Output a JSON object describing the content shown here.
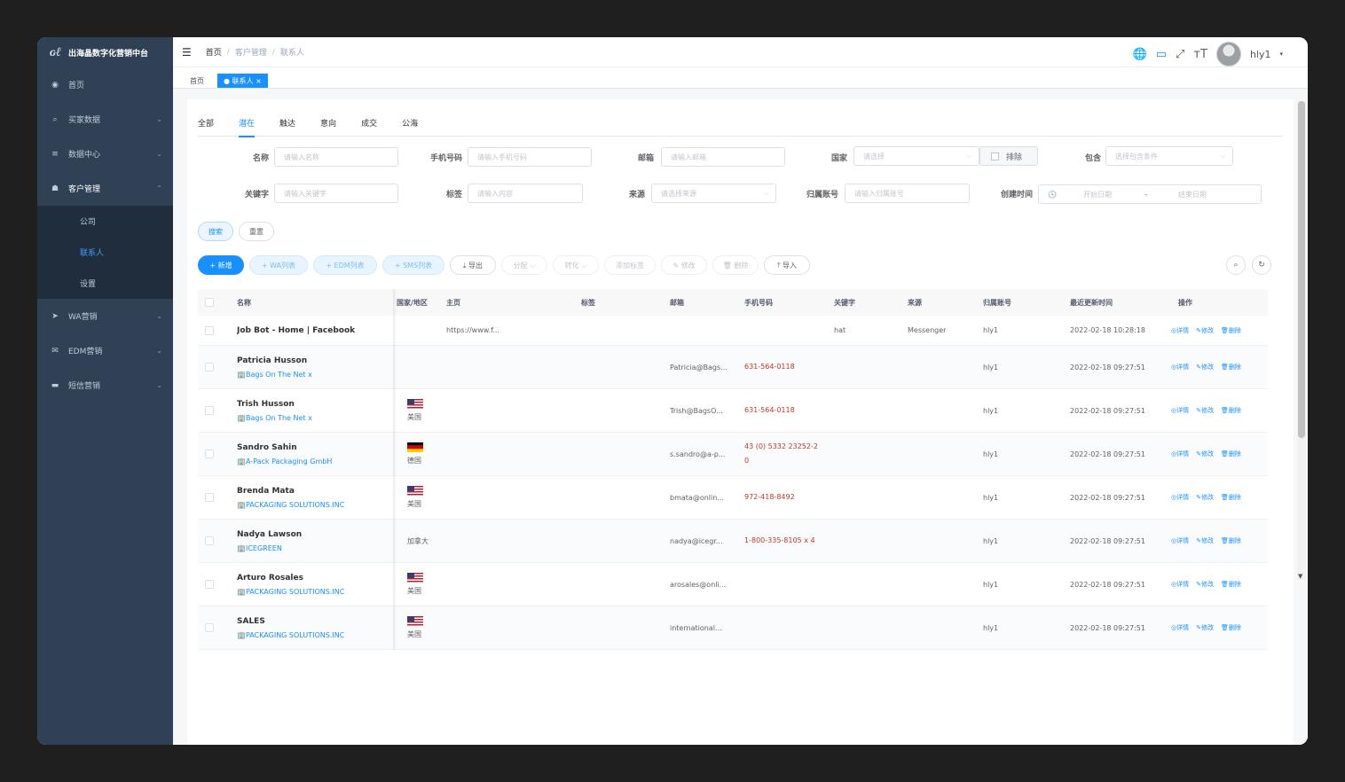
{
  "app": {
    "title": "出海晶数字化营销中台"
  },
  "sidebar": {
    "items": [
      {
        "label": "首页",
        "icon": "dashboard-icon",
        "has_children": false
      },
      {
        "label": "买家数据",
        "icon": "search-icon",
        "has_children": true
      },
      {
        "label": "数据中心",
        "icon": "list-icon",
        "has_children": true
      },
      {
        "label": "客户管理",
        "icon": "customer-icon",
        "has_children": true,
        "expanded": true,
        "children": [
          {
            "label": "公司"
          },
          {
            "label": "联系人",
            "active": true
          },
          {
            "label": "设置"
          }
        ]
      },
      {
        "label": "WA营销",
        "icon": "send-icon",
        "has_children": true
      },
      {
        "label": "EDM营销",
        "icon": "mail-icon",
        "has_children": true
      },
      {
        "label": "短信营销",
        "icon": "message-icon",
        "has_children": true
      }
    ]
  },
  "navbar": {
    "breadcrumb": [
      "首页",
      "客户管理",
      "联系人"
    ],
    "username": "hly1"
  },
  "tagsview": {
    "tags": [
      {
        "label": "首页"
      },
      {
        "label": "● 联系人 ×",
        "active": true
      }
    ]
  },
  "tabs": [
    "全部",
    "潜在",
    "触达",
    "意向",
    "成交",
    "公海"
  ],
  "active_tab": "潜在",
  "filters": {
    "name": {
      "label": "名称",
      "placeholder": "请输入名称"
    },
    "phone": {
      "label": "手机号码",
      "placeholder": "请输入手机号码"
    },
    "email": {
      "label": "邮箱",
      "placeholder": "请输入邮箱"
    },
    "country": {
      "label": "国家",
      "placeholder": "请选择"
    },
    "exclude": {
      "label": "排除"
    },
    "include": {
      "label": "包含",
      "placeholder": "选择包含条件"
    },
    "keyword": {
      "label": "关键字",
      "placeholder": "请输入关键字"
    },
    "tag": {
      "label": "标签",
      "placeholder": "请输入内容"
    },
    "source": {
      "label": "来源",
      "placeholder": "请选择来源"
    },
    "account": {
      "label": "归属账号",
      "placeholder": "请输入归属账号"
    },
    "created": {
      "label": "创建时间",
      "start": "开始日期",
      "dash": "-",
      "end": "结束日期"
    }
  },
  "buttons": {
    "search": "搜索",
    "reset": "重置",
    "add": "+ 新增",
    "wa_list": "+ WA列表",
    "edm_list": "+ EDM列表",
    "sms_list": "+ SMS列表",
    "export": "⤓ 导出",
    "assign": "分配 ⌵",
    "transfer": "转化 ⌵",
    "add_tag": "添加标签",
    "edit": "✎ 修改",
    "delete": "🗑 删除",
    "import": "⤒ 导入"
  },
  "table": {
    "headers": [
      "名称",
      "国家/地区",
      "主页",
      "标签",
      "邮箱",
      "手机号码",
      "关键字",
      "来源",
      "归属账号",
      "最近更新时间",
      "操作"
    ],
    "ops": {
      "detail": "◎详情",
      "edit": "✎修改",
      "delete": "🗑删除"
    },
    "rows": [
      {
        "name": "Job Bot - Home | Facebook",
        "company": "",
        "country": "",
        "flag": "",
        "homepage": "https://www.f...",
        "email": "",
        "phone": "",
        "keyword": "hat",
        "source": "Messenger",
        "account": "hly1",
        "updated": "2022-02-18 10:28:18"
      },
      {
        "name": "Patricia Husson",
        "company": "Bags On The Net x",
        "country": "",
        "flag": "",
        "homepage": "",
        "email": "Patricia@Bags...",
        "phone": "631-564-0118",
        "keyword": "",
        "source": "",
        "account": "hly1",
        "updated": "2022-02-18 09:27:51"
      },
      {
        "name": "Trish Husson",
        "company": "Bags On The Net x",
        "country": "美国",
        "flag": "us",
        "homepage": "",
        "email": "Trish@BagsO...",
        "phone": "631-564-0118",
        "keyword": "",
        "source": "",
        "account": "hly1",
        "updated": "2022-02-18 09:27:51"
      },
      {
        "name": "Sandro Sahin",
        "company": "A-Pack Packaging GmbH",
        "country": "德国",
        "flag": "de",
        "homepage": "",
        "email": "s.sandro@a-p...",
        "phone": "43 (0) 5332 23252-2\n0",
        "keyword": "",
        "source": "",
        "account": "hly1",
        "updated": "2022-02-18 09:27:51"
      },
      {
        "name": "Brenda Mata",
        "company": "PACKAGING SOLUTIONS.INC",
        "country": "美国",
        "flag": "us",
        "homepage": "",
        "email": "bmata@onlin...",
        "phone": "972-418-8492",
        "keyword": "",
        "source": "",
        "account": "hly1",
        "updated": "2022-02-18 09:27:51"
      },
      {
        "name": "Nadya Lawson",
        "company": "ICEGREEN",
        "country": "加拿大",
        "flag": "",
        "homepage": "",
        "email": "nadya@icegr...",
        "phone": "1-800-335-8105 x 4",
        "keyword": "",
        "source": "",
        "account": "hly1",
        "updated": "2022-02-18 09:27:51"
      },
      {
        "name": "Arturo Rosales",
        "company": "PACKAGING SOLUTIONS.INC",
        "country": "美国",
        "flag": "us",
        "homepage": "",
        "email": "arosales@onli...",
        "phone": "",
        "keyword": "",
        "source": "",
        "account": "hly1",
        "updated": "2022-02-18 09:27:51"
      },
      {
        "name": "SALES",
        "company": "PACKAGING SOLUTIONS.INC",
        "country": "美国",
        "flag": "us",
        "homepage": "",
        "email": "international...",
        "phone": "",
        "keyword": "",
        "source": "",
        "account": "hly1",
        "updated": "2022-02-18 09:27:51"
      }
    ]
  },
  "colors": {
    "primary": "#1890ff",
    "sidebar_bg": "#304156",
    "phone": "#c0392b"
  }
}
